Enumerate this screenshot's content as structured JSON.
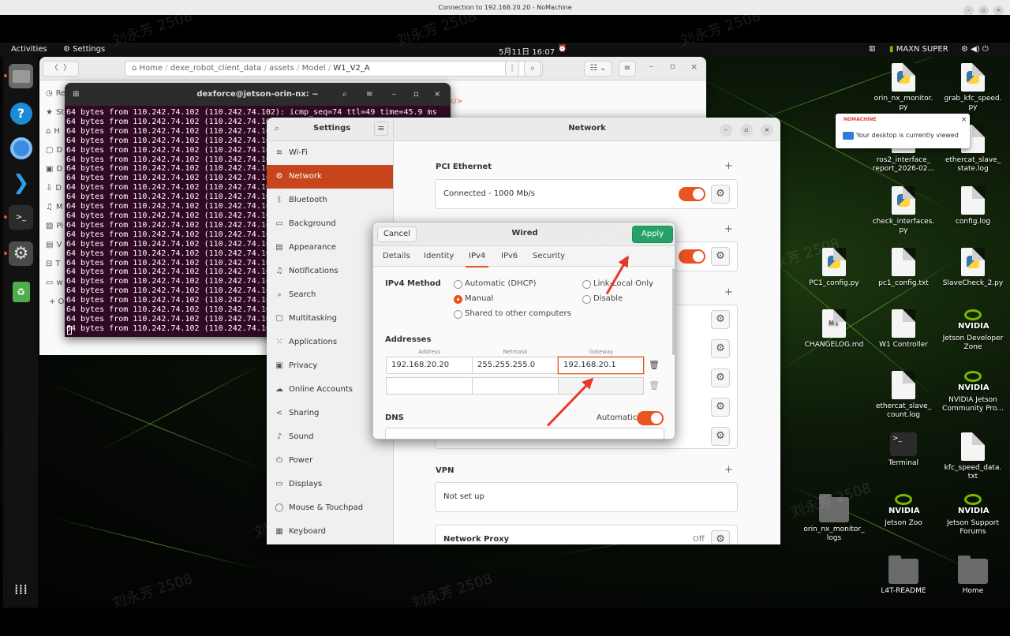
{
  "nx": {
    "title": "Connection to 192.168.20.20 - NoMachine",
    "notify_brand": "NOMACHINE",
    "notify_text": "Your desktop is currently viewed",
    "notify_close": "×"
  },
  "topbar": {
    "activities": "Activities",
    "app": "Settings",
    "clock": "5月11日 16:07",
    "power_mode": "MAXN SUPER"
  },
  "files": {
    "path": [
      "Home",
      "dexe_robot_client_data",
      "assets",
      "Model"
    ],
    "path_current": "W1_V2_A",
    "sidebar_initials": [
      "Re",
      "St",
      "H",
      "D",
      "D",
      "D",
      "M",
      "Pi",
      "V",
      "T",
      "w",
      "+ O"
    ]
  },
  "terminal": {
    "title": "dexforce@jetson-orin-nx: ~",
    "lines": [
      "64 bytes from 110.242.74.102 (110.242.74.102): icmp_seq=74 ttl=49 time=45.9 ms",
      "64 bytes from 110.242.74.102 (110.242.74.10",
      "64 bytes from 110.242.74.102 (110.242.74.10",
      "64 bytes from 110.242.74.102 (110.242.74.10",
      "64 bytes from 110.242.74.102 (110.242.74.10",
      "64 bytes from 110.242.74.102 (110.242.74.10",
      "64 bytes from 110.242.74.102 (110.242.74.10",
      "64 bytes from 110.242.74.102 (110.242.74.10",
      "64 bytes from 110.242.74.102 (110.242.74.10",
      "64 bytes from 110.242.74.102 (110.242.74.10",
      "64 bytes from 110.242.74.102 (110.242.74.10",
      "64 bytes from 110.242.74.102 (110.242.74.10",
      "64 bytes from 110.242.74.102 (110.242.74.10",
      "64 bytes from 110.242.74.102 (110.242.74.10",
      "64 bytes from 110.242.74.102 (110.242.74.10",
      "64 bytes from 110.242.74.102 (110.242.74.10",
      "64 bytes from 110.242.74.102 (110.242.74.10",
      "64 bytes from 110.242.74.102 (110.242.74.10",
      "64 bytes from 110.242.74.102 (110.242.74.10",
      "64 bytes from 110.242.74.102 (110.242.74.10",
      "64 bytes from 110.242.74.102 (110.242.74.10",
      "64 bytes from 110.242.74.102 (110.242.74.10",
      "64 bytes from 110.242.74.102 (110.242.74.10",
      "64 bytes from 110.242.74.102 (110.242.74.10"
    ]
  },
  "settings": {
    "title": "Settings",
    "panel_title": "Network",
    "sidebar": [
      {
        "label": "Wi-Fi",
        "icon": "wifi-icon",
        "glyph": "≋"
      },
      {
        "label": "Network",
        "icon": "network-icon",
        "glyph": "⚙",
        "active": true
      },
      {
        "label": "Bluetooth",
        "icon": "bluetooth-icon",
        "glyph": "ᛒ"
      },
      {
        "label": "Background",
        "icon": "background-icon",
        "glyph": "▭"
      },
      {
        "label": "Appearance",
        "icon": "appearance-icon",
        "glyph": "▤"
      },
      {
        "label": "Notifications",
        "icon": "bell-icon",
        "glyph": "♫"
      },
      {
        "label": "Search",
        "icon": "search-icon",
        "glyph": "⌕"
      },
      {
        "label": "Multitasking",
        "icon": "multitasking-icon",
        "glyph": "▢"
      },
      {
        "label": "Applications",
        "icon": "applications-icon",
        "glyph": "⁙"
      },
      {
        "label": "Privacy",
        "icon": "lock-icon",
        "glyph": "▣"
      },
      {
        "label": "Online Accounts",
        "icon": "cloud-icon",
        "glyph": "☁"
      },
      {
        "label": "Sharing",
        "icon": "share-icon",
        "glyph": "<"
      },
      {
        "label": "Sound",
        "icon": "sound-icon",
        "glyph": "♪"
      },
      {
        "label": "Power",
        "icon": "power-icon",
        "glyph": "⏻"
      },
      {
        "label": "Displays",
        "icon": "display-icon",
        "glyph": "▭"
      },
      {
        "label": "Mouse & Touchpad",
        "icon": "mouse-icon",
        "glyph": "◯"
      },
      {
        "label": "Keyboard",
        "icon": "keyboard-icon",
        "glyph": "▦"
      }
    ],
    "pci_title": "PCI Ethernet",
    "pci_status": "Connected - 1000 Mb/s",
    "vpn_title": "VPN",
    "vpn_status": "Not set up",
    "proxy_title": "Network Proxy",
    "proxy_status": "Off"
  },
  "wired": {
    "cancel": "Cancel",
    "title": "Wired",
    "apply": "Apply",
    "tabs": [
      "Details",
      "Identity",
      "IPv4",
      "IPv6",
      "Security"
    ],
    "active_tab": "IPv4",
    "method_label": "IPv4 Method",
    "methods": {
      "dhcp": "Automatic (DHCP)",
      "link_local": "Link-Local Only",
      "manual": "Manual",
      "disable": "Disable",
      "shared": "Shared to other computers"
    },
    "selected_method": "Manual",
    "addresses_label": "Addresses",
    "col_address": "Address",
    "col_netmask": "Netmask",
    "col_gateway": "Gateway",
    "address": "192.168.20.20",
    "netmask": "255.255.255.0",
    "gateway": "192.168.20.1",
    "dns_label": "DNS",
    "dns_auto_label": "Automatic"
  },
  "desktop_icons": [
    {
      "label": "orin_nx_monitor.\npy",
      "kind": "py"
    },
    {
      "label": "grab_kfc_speed.\npy",
      "kind": "py"
    },
    {
      "label": "ros2_interface_\nreport_2026-02...",
      "kind": "file"
    },
    {
      "label": "ethercat_slave_\nstate.log",
      "kind": "file"
    },
    {
      "label": "check_interfaces.\npy",
      "kind": "py"
    },
    {
      "label": "config.log",
      "kind": "file"
    },
    {
      "label": "PC1_config.py",
      "kind": "py"
    },
    {
      "label": "pc1_config.txt",
      "kind": "file"
    },
    {
      "label": "SlaveCheck_2.py",
      "kind": "py"
    },
    {
      "label": "CHANGELOG.md",
      "kind": "md"
    },
    {
      "label": "W1 Controller",
      "kind": "file"
    },
    {
      "label": "Jetson Developer\nZone",
      "kind": "nvidia"
    },
    {
      "label": "ethercat_slave_\ncount.log",
      "kind": "file"
    },
    {
      "label": "NVIDIA Jetson\nCommunity Pro...",
      "kind": "nvidia"
    },
    {
      "label": "Terminal",
      "kind": "term"
    },
    {
      "label": "kfc_speed_data.\ntxt",
      "kind": "file"
    },
    {
      "label": "orin_nx_monitor_\nlogs",
      "kind": "folder"
    },
    {
      "label": "Jetson Zoo",
      "kind": "nvidia"
    },
    {
      "label": "Jetson Support\nForums",
      "kind": "nvidia"
    },
    {
      "label": "L4T-README",
      "kind": "folder"
    },
    {
      "label": "Home",
      "kind": "folder"
    }
  ],
  "nvidia_word": "NVIDIA",
  "watermark": "刘永芳 2508",
  "colors": {
    "accent": "#e95420",
    "apply_green": "#26a269",
    "annotation_red": "#e8382c"
  }
}
